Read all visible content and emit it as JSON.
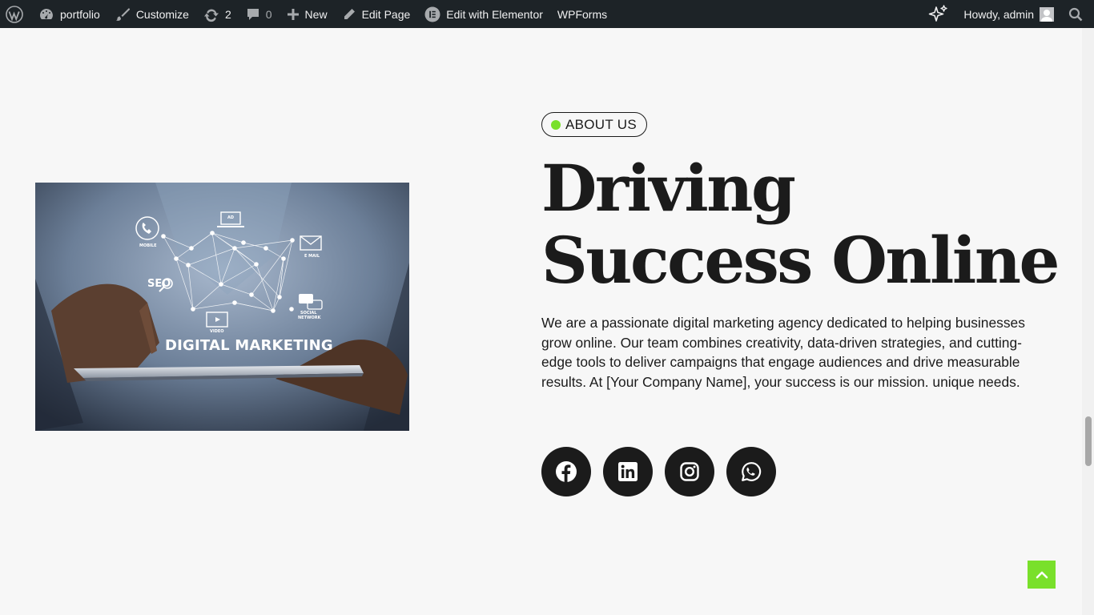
{
  "admin_bar": {
    "site_name": "portfolio",
    "customize": "Customize",
    "updates_count": "2",
    "comments_count": "0",
    "new": "New",
    "edit_page": "Edit Page",
    "edit_elementor": "Edit with Elementor",
    "wpforms": "WPForms",
    "howdy": "Howdy, admin"
  },
  "image": {
    "caption": "DIGITAL MARKETING",
    "labels": [
      "MOBILE",
      "AD",
      "E MAIL",
      "SEO",
      "SOCIAL",
      "NETWORK",
      "VIDEO"
    ]
  },
  "about": {
    "badge": "ABOUT US",
    "headline_line1": "Driving",
    "headline_line2": "Success Online",
    "paragraph": "We are a passionate digital marketing agency dedicated to helping businesses grow online. Our team combines creativity, data-driven strategies, and cutting-edge tools to deliver campaigns that engage audiences and drive measurable results. At [Your Company Name], your success is our mission. unique needs."
  },
  "social_icons": [
    "facebook-icon",
    "linkedin-icon",
    "instagram-icon",
    "whatsapp-icon"
  ],
  "colors": {
    "accent_green": "#79e02b",
    "dark": "#1b1b1b",
    "admin_bar": "#1d2327",
    "page_bg": "#f7f7f7"
  }
}
